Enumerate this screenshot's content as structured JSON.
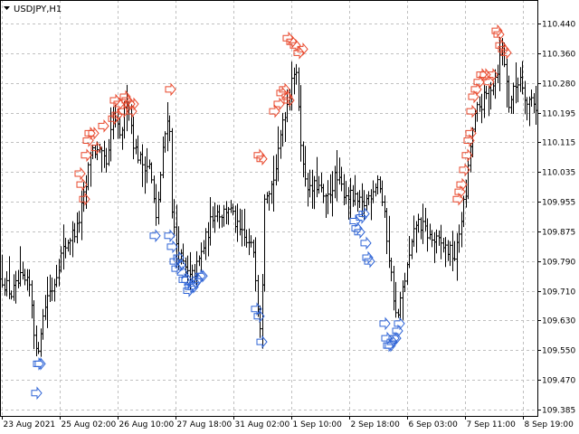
{
  "chart_data": {
    "type": "bar",
    "subtype": "ohlc-price-chart",
    "title": "USDJPY,H1",
    "symbol": "USDJPY",
    "timeframe": "H1",
    "colors": {
      "background": "#ffffff",
      "bars": "#000000",
      "grid": "#c0c0c0",
      "sell_arrow": "#e8472b",
      "buy_arrow": "#2f64d6"
    },
    "grid": true,
    "ylim": [
      109.385,
      110.44
    ],
    "yticks": [
      "110.440",
      "110.360",
      "110.280",
      "110.195",
      "110.115",
      "110.035",
      "109.955",
      "109.875",
      "109.790",
      "109.710",
      "109.630",
      "109.550",
      "109.470",
      "109.385"
    ],
    "xticks": [
      "23 Aug 2021",
      "25 Aug 02:00",
      "26 Aug 10:00",
      "27 Aug 18:00",
      "31 Aug 02:00",
      "1 Sep 10:00",
      "2 Sep 18:00",
      "6 Sep 03:00",
      "7 Sep 11:00",
      "8 Sep 19:00"
    ],
    "anchors": [
      [
        0,
        109.75
      ],
      [
        12,
        109.7
      ],
      [
        22,
        109.74
      ],
      [
        33,
        109.72
      ],
      [
        40,
        109.52
      ],
      [
        44,
        109.6
      ],
      [
        52,
        109.7
      ],
      [
        58,
        109.72
      ],
      [
        66,
        109.8
      ],
      [
        75,
        109.85
      ],
      [
        85,
        109.88
      ],
      [
        95,
        110.0
      ],
      [
        100,
        110.1
      ],
      [
        110,
        110.08
      ],
      [
        118,
        110.05
      ],
      [
        125,
        110.2
      ],
      [
        132,
        110.12
      ],
      [
        140,
        110.24
      ],
      [
        148,
        110.1
      ],
      [
        156,
        110.06
      ],
      [
        165,
        110.05
      ],
      [
        172,
        109.9
      ],
      [
        180,
        110.1
      ],
      [
        186,
        110.22
      ],
      [
        190,
        109.9
      ],
      [
        196,
        109.82
      ],
      [
        202,
        109.78
      ],
      [
        210,
        109.74
      ],
      [
        218,
        109.78
      ],
      [
        228,
        109.86
      ],
      [
        236,
        109.93
      ],
      [
        245,
        109.92
      ],
      [
        252,
        109.94
      ],
      [
        262,
        109.88
      ],
      [
        272,
        109.84
      ],
      [
        280,
        109.82
      ],
      [
        285,
        109.66
      ],
      [
        288,
        109.6
      ],
      [
        292,
        109.98
      ],
      [
        300,
        110.0
      ],
      [
        306,
        110.06
      ],
      [
        312,
        110.18
      ],
      [
        318,
        110.23
      ],
      [
        323,
        110.32
      ],
      [
        328,
        110.28
      ],
      [
        334,
        110.05
      ],
      [
        342,
        109.98
      ],
      [
        350,
        110.0
      ],
      [
        360,
        109.95
      ],
      [
        370,
        110.02
      ],
      [
        380,
        109.98
      ],
      [
        390,
        109.96
      ],
      [
        400,
        109.94
      ],
      [
        410,
        109.98
      ],
      [
        418,
        110.02
      ],
      [
        425,
        109.9
      ],
      [
        432,
        109.75
      ],
      [
        438,
        109.62
      ],
      [
        445,
        109.72
      ],
      [
        452,
        109.8
      ],
      [
        460,
        109.9
      ],
      [
        468,
        109.88
      ],
      [
        476,
        109.85
      ],
      [
        485,
        109.84
      ],
      [
        495,
        109.82
      ],
      [
        503,
        109.8
      ],
      [
        510,
        109.92
      ],
      [
        515,
        109.98
      ],
      [
        520,
        110.12
      ],
      [
        526,
        110.2
      ],
      [
        532,
        110.22
      ],
      [
        540,
        110.26
      ],
      [
        548,
        110.3
      ],
      [
        555,
        110.38
      ],
      [
        562,
        110.22
      ],
      [
        568,
        110.26
      ],
      [
        575,
        110.3
      ],
      [
        582,
        110.22
      ],
      [
        588,
        110.24
      ],
      [
        594,
        110.2
      ]
    ],
    "sell_signals": [
      [
        88,
        110.03
      ],
      [
        90,
        110.0
      ],
      [
        93,
        109.96
      ],
      [
        95,
        110.08
      ],
      [
        97,
        110.12
      ],
      [
        99,
        110.14
      ],
      [
        103,
        110.14
      ],
      [
        106,
        110.1
      ],
      [
        114,
        110.16
      ],
      [
        125,
        110.18
      ],
      [
        127,
        110.23
      ],
      [
        129,
        110.19
      ],
      [
        131,
        110.22
      ],
      [
        136,
        110.2
      ],
      [
        138,
        110.24
      ],
      [
        140,
        110.23
      ],
      [
        143,
        110.22
      ],
      [
        145,
        110.2
      ],
      [
        147,
        110.22
      ],
      [
        188,
        110.26
      ],
      [
        286,
        110.08
      ],
      [
        289,
        110.07
      ],
      [
        303,
        110.2
      ],
      [
        308,
        110.22
      ],
      [
        311,
        110.25
      ],
      [
        314,
        110.26
      ],
      [
        317,
        110.24
      ],
      [
        319,
        110.23
      ],
      [
        318,
        110.4
      ],
      [
        322,
        110.39
      ],
      [
        326,
        110.38
      ],
      [
        330,
        110.36
      ],
      [
        334,
        110.37
      ],
      [
        506,
        109.96
      ],
      [
        508,
        109.98
      ],
      [
        510,
        110.0
      ],
      [
        513,
        110.04
      ],
      [
        516,
        110.08
      ],
      [
        518,
        110.12
      ],
      [
        520,
        110.14
      ],
      [
        521,
        110.2
      ],
      [
        523,
        110.24
      ],
      [
        526,
        110.26
      ],
      [
        529,
        110.28
      ],
      [
        532,
        110.3
      ],
      [
        536,
        110.3
      ],
      [
        540,
        110.28
      ],
      [
        544,
        110.3
      ],
      [
        549,
        110.42
      ],
      [
        551,
        110.41
      ],
      [
        553,
        110.38
      ],
      [
        556,
        110.37
      ],
      [
        559,
        110.36
      ]
    ],
    "buy_signals": [
      [
        40,
        109.43
      ],
      [
        42,
        109.51
      ],
      [
        44,
        109.51
      ],
      [
        171,
        109.86
      ],
      [
        187,
        109.86
      ],
      [
        190,
        109.83
      ],
      [
        193,
        109.79
      ],
      [
        195,
        109.77
      ],
      [
        197,
        109.8
      ],
      [
        199,
        109.78
      ],
      [
        201,
        109.76
      ],
      [
        203,
        109.74
      ],
      [
        206,
        109.74
      ],
      [
        208,
        109.71
      ],
      [
        210,
        109.72
      ],
      [
        213,
        109.72
      ],
      [
        215,
        109.73
      ],
      [
        218,
        109.74
      ],
      [
        221,
        109.75
      ],
      [
        223,
        109.75
      ],
      [
        283,
        109.66
      ],
      [
        286,
        109.64
      ],
      [
        289,
        109.57
      ],
      [
        392,
        109.9
      ],
      [
        394,
        109.88
      ],
      [
        397,
        109.87
      ],
      [
        399,
        109.91
      ],
      [
        402,
        109.92
      ],
      [
        404,
        109.84
      ],
      [
        406,
        109.8
      ],
      [
        408,
        109.79
      ],
      [
        425,
        109.62
      ],
      [
        427,
        109.58
      ],
      [
        429,
        109.56
      ],
      [
        431,
        109.56
      ],
      [
        433,
        109.57
      ],
      [
        435,
        109.58
      ],
      [
        437,
        109.58
      ],
      [
        439,
        109.6
      ],
      [
        441,
        109.62
      ]
    ]
  }
}
